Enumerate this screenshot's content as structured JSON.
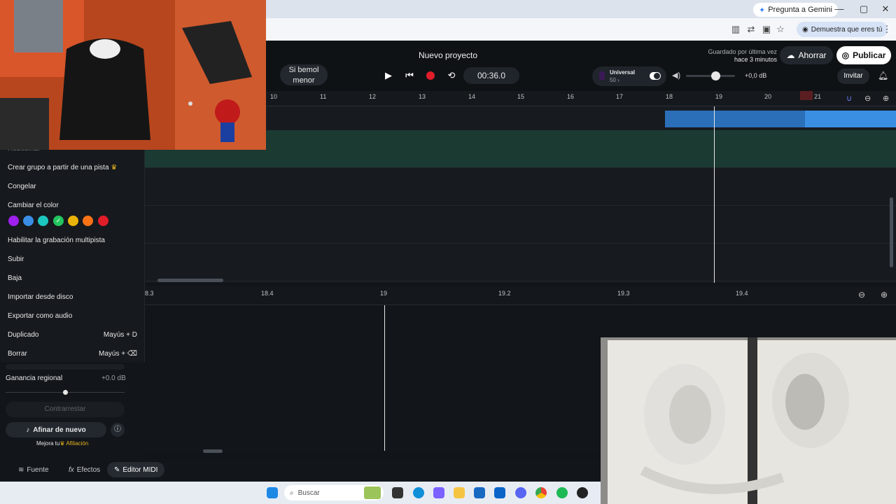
{
  "browser": {
    "gemini_label": "Pregunta a Gemini",
    "verify_label": "Demuestra que eres tú",
    "win_min": "—",
    "win_max": "▢",
    "win_close": "✕"
  },
  "header": {
    "project_title": "Nuevo proyecto",
    "key_line1": "Si bemol",
    "key_line2": "menor",
    "time": "00:36.0",
    "universal_label": "Universal",
    "universal_sub": "50 ›",
    "volume_db": "+0,0 dB",
    "saved_line1": "Guardado por última vez",
    "saved_line2": "hace 3 minutos",
    "save_label": "Ahorrar",
    "publish_label": "Publicar",
    "invite_label": "Invitar"
  },
  "ruler": [
    "10",
    "11",
    "12",
    "13",
    "14",
    "15",
    "16",
    "17",
    "18",
    "19",
    "20",
    "21"
  ],
  "ruler2": [
    "8.3",
    "18.4",
    "19",
    "19.2",
    "19.3",
    "19.4"
  ],
  "menu": {
    "partial_top": "Rebobinar",
    "items": [
      {
        "label": "Crear grupo a partir de una pista",
        "shortcut": ""
      },
      {
        "label": "Congelar",
        "shortcut": ""
      },
      {
        "label": "Cambiar el color",
        "shortcut": ""
      },
      {
        "label": "Habilitar la grabación multipista",
        "shortcut": ""
      },
      {
        "label": "Subir",
        "shortcut": ""
      },
      {
        "label": "Baja",
        "shortcut": ""
      },
      {
        "label": "Importar desde disco",
        "shortcut": ""
      },
      {
        "label": "Exportar como audio",
        "shortcut": ""
      },
      {
        "label": "Duplicado",
        "shortcut": "Mayús + D"
      },
      {
        "label": "Borrar",
        "shortcut": "Mayús + ⌫"
      }
    ],
    "colors": [
      "#a020f0",
      "#3a8ee6",
      "#1cc7c0",
      "#22c55e",
      "#eab308",
      "#f97316",
      "#e11d2a"
    ]
  },
  "left_panel": {
    "gain_label": "Ganancia regional",
    "gain_value": "+0.0 dB",
    "counteract_label": "Contrarrestar",
    "retune_label": "Afinar de nuevo",
    "upgrade_prefix": "Mejora tu",
    "upgrade_link": "Afiliación"
  },
  "bottom_tabs": {
    "source": "Fuente",
    "effects": "Efectos",
    "midi": "Editor MIDI"
  },
  "taskbar": {
    "search_placeholder": "Buscar"
  }
}
